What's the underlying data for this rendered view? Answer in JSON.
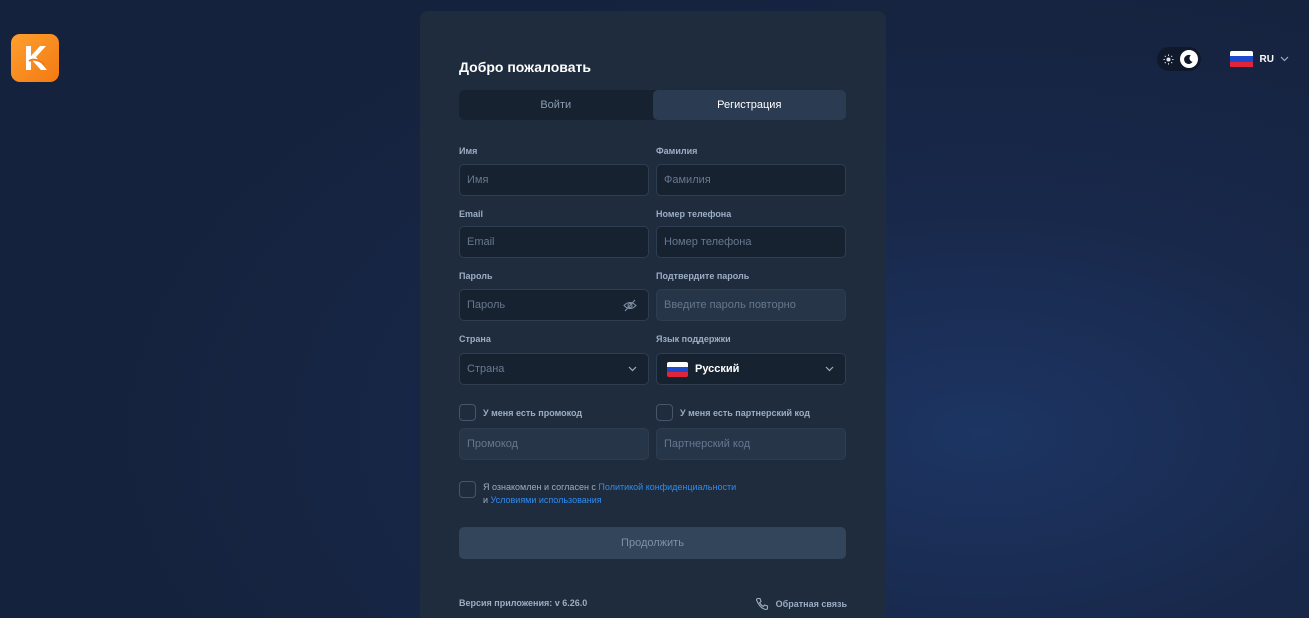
{
  "header": {
    "theme_toggle": {
      "sun_icon": "sun-icon",
      "moon_icon": "moon-icon",
      "selected": "dark"
    },
    "language": {
      "code": "RU",
      "flag": "russia-flag"
    }
  },
  "card": {
    "title": "Добро пожаловать",
    "tabs": [
      {
        "label": "Войти",
        "active": false
      },
      {
        "label": "Регистрация",
        "active": true
      }
    ],
    "fields": {
      "first_name": {
        "label": "Имя",
        "placeholder": "Имя"
      },
      "last_name": {
        "label": "Фамилия",
        "placeholder": "Фамилия"
      },
      "email": {
        "label": "Email",
        "placeholder": "Email"
      },
      "phone": {
        "label": "Номер телефона",
        "placeholder": "Номер телефона"
      },
      "password": {
        "label": "Пароль",
        "placeholder": "Пароль"
      },
      "confirm_password": {
        "label": "Подтвердите пароль",
        "placeholder": "Введите пароль повторно"
      },
      "country": {
        "label": "Страна",
        "placeholder": "Страна"
      },
      "support_language": {
        "label": "Язык поддержки",
        "value": "Русский"
      },
      "promo": {
        "checkbox_label": "У меня есть промокод",
        "placeholder": "Промокод"
      },
      "partner": {
        "checkbox_label": "У меня есть партнерский код",
        "placeholder": "Партнерский код"
      }
    },
    "terms": {
      "prefix": "Я ознакомлен и согласен с ",
      "privacy_link": "Политикой конфиденциальности",
      "conjunction": "и ",
      "terms_link": "Условиями использования"
    },
    "submit_label": "Продолжить",
    "footer": {
      "version": "Версия приложения: v 6.26.0",
      "feedback": "Обратная связь"
    }
  },
  "colors": {
    "accent_orange": "#f7901e",
    "link_blue": "#2f8cf2",
    "card_bg": "#1e2c3d"
  }
}
